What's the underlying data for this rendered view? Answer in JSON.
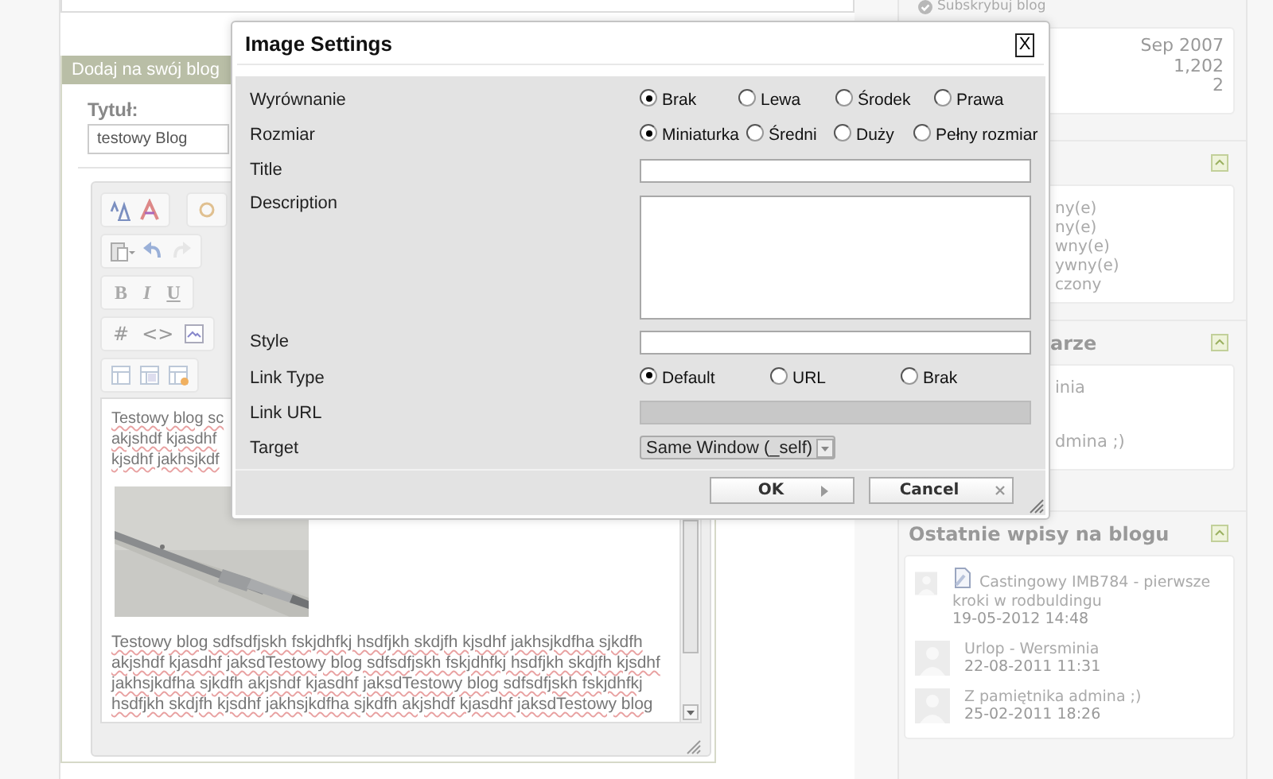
{
  "sidebar": {
    "subscribe_link": "Subskrybuj blog",
    "stats": [
      "Sep 2007",
      "1,202",
      "2"
    ],
    "widget_1": {
      "lines": [
        "ny(e)",
        "ny(e)",
        "wny(e)",
        "ywny(e)",
        "czony"
      ]
    },
    "widget_2": {
      "title": "arze",
      "lines": [
        "inia",
        "dmina ;)"
      ]
    },
    "recent_posts": {
      "title": "Ostatnie wpisy na blogu",
      "posts": [
        {
          "kind": "attachment",
          "title": "Castingowy IMB784 - pierwsze kroki w rodbuldingu",
          "date": "19-05-2012 14:48"
        },
        {
          "kind": "plain",
          "title": "Urlop - Wersminia",
          "date": "22-08-2011 11:31"
        },
        {
          "kind": "plain",
          "title": "Z pamiętnika admina ;)",
          "date": "25-02-2011 18:26"
        }
      ]
    }
  },
  "editor_panel": {
    "header": "Dodaj na swój blog",
    "title_label": "Tytuł:",
    "title_value": "testowy Blog",
    "format_buttons": [
      "B",
      "I",
      "U"
    ],
    "code_buttons": [
      "#",
      "<>"
    ],
    "text_top": "Testowy blog sc\nakjshdf kjasdhf\nkjsdhf jakhsjkdf",
    "text_bottom": "Testowy blog sdfsdfjskh fskjdhfkj hsdfjkh skdjfh kjsdhf jakhsjkdfha sjkdfh\nakjshdf kjasdhf jaksdTestowy blog sdfsdfjskh fskjdhfkj hsdfjkh skdjfh kjsdhf\njakhsjkdfha sjkdfh akjshdf kjasdhf jaksdTestowy blog sdfsdfjskh fskjdhfkj\nhsdfjkh skdjfh kjsdhf jakhsjkdfha sjkdfh akjshdf kjasdhf jaksdTestowy blog"
  },
  "dialog": {
    "title": "Image Settings",
    "close_label": "X",
    "rows": [
      {
        "label": "Wyrównanie",
        "kind": "radio",
        "options": [
          {
            "label": "Brak",
            "selected": true
          },
          {
            "label": "Lewa",
            "selected": false
          },
          {
            "label": "Środek",
            "selected": false
          },
          {
            "label": "Prawa",
            "selected": false
          }
        ]
      },
      {
        "label": "Rozmiar",
        "kind": "radio",
        "options": [
          {
            "label": "Miniaturka",
            "selected": true
          },
          {
            "label": "Średni",
            "selected": false
          },
          {
            "label": "Duży",
            "selected": false
          },
          {
            "label": "Pełny rozmiar",
            "selected": false
          }
        ]
      },
      {
        "label": "Title",
        "kind": "text",
        "disabled": false
      },
      {
        "label": "Description",
        "kind": "textarea",
        "disabled": false
      },
      {
        "label": "Style",
        "kind": "text",
        "disabled": false
      },
      {
        "label": "Link Type",
        "kind": "radio",
        "options": [
          {
            "label": "Default",
            "selected": true
          },
          {
            "label": "URL",
            "selected": false
          },
          {
            "label": "Brak",
            "selected": false
          }
        ]
      },
      {
        "label": "Link URL",
        "kind": "text",
        "disabled": true
      },
      {
        "label": "Target",
        "kind": "select",
        "value": "Same Window (_self)"
      }
    ],
    "buttons": [
      {
        "label": "OK",
        "kind": "ok"
      },
      {
        "label": "Cancel",
        "kind": "cancel"
      }
    ]
  }
}
